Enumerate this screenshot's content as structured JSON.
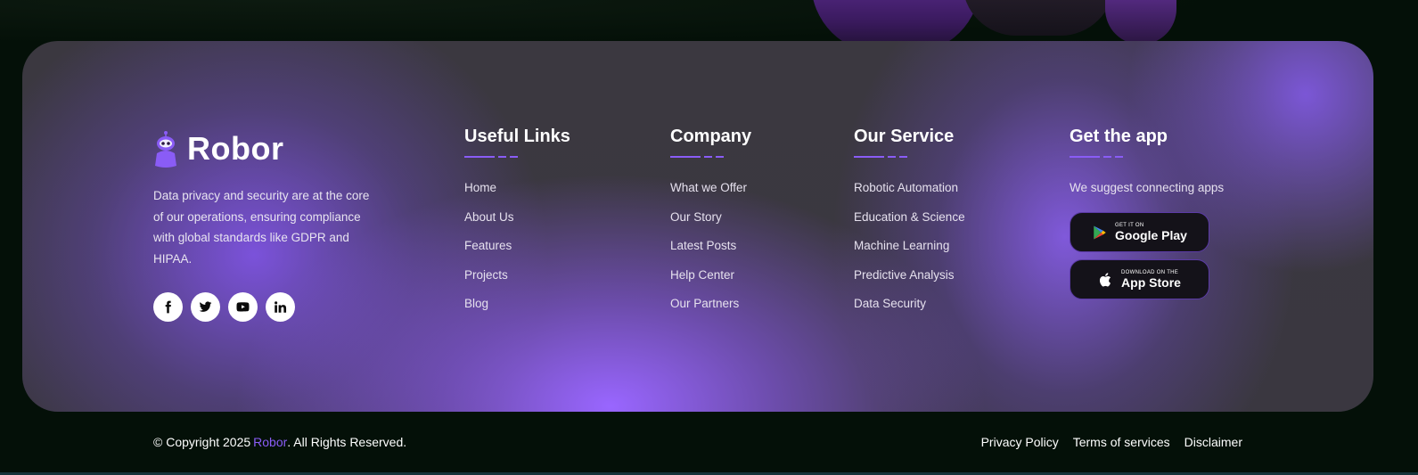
{
  "brand": {
    "name": "Robor",
    "description": "Data privacy and security are at the core of our operations, ensuring compliance with global standards like GDPR and HIPAA."
  },
  "socials": [
    {
      "icon": "facebook-icon"
    },
    {
      "icon": "twitter-icon"
    },
    {
      "icon": "youtube-icon"
    },
    {
      "icon": "linkedin-icon"
    }
  ],
  "useful_links": {
    "title": "Useful Links",
    "items": [
      "Home",
      "About Us",
      "Features",
      "Projects",
      "Blog"
    ]
  },
  "company": {
    "title": "Company",
    "items": [
      "What we Offer",
      "Our Story",
      "Latest Posts",
      "Help Center",
      "Our Partners"
    ]
  },
  "our_service": {
    "title": "Our Service",
    "items": [
      "Robotic Automation",
      "Education & Science",
      "Machine Learning",
      "Predictive Analysis",
      "Data Security"
    ]
  },
  "get_app": {
    "title": "Get the app",
    "subtitle": "We suggest connecting apps",
    "google_play": {
      "small": "GET IT ON",
      "big": "Google Play"
    },
    "app_store": {
      "small": "DOWNLOAD ON THE",
      "big": "App Store"
    }
  },
  "bottom": {
    "copyright_prefix": "© Copyright 2025",
    "copyright_brand": "Robor",
    "copyright_suffix": ". All Rights Reserved.",
    "legal_links": [
      "Privacy Policy",
      "Terms of services",
      "Disclaimer"
    ]
  },
  "colors": {
    "accent": "#8a5cf6",
    "background": "#041008",
    "card": "#3a3740"
  }
}
